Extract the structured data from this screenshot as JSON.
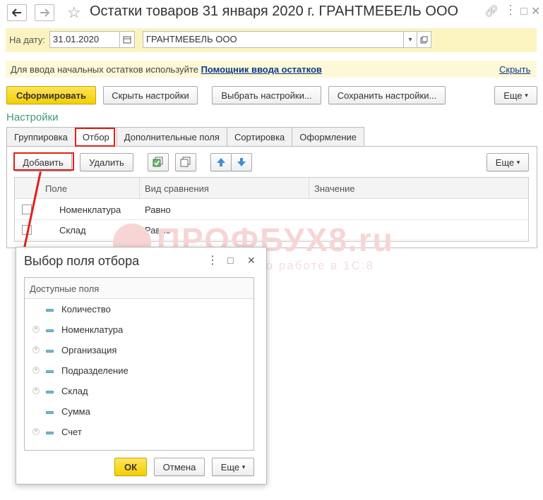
{
  "window": {
    "title": "Остатки товаров 31 января 2020 г. ГРАНТМЕБЕЛЬ ООО"
  },
  "filter": {
    "date_label": "На дату:",
    "date_value": "31.01.2020",
    "org_value": "ГРАНТМЕБЕЛЬ ООО"
  },
  "info": {
    "text": "Для ввода начальных остатков используйте",
    "link": "Помощник ввода остатков",
    "hide": "Скрыть"
  },
  "toolbar": {
    "generate": "Сформировать",
    "hide_settings": "Скрыть настройки",
    "choose_settings": "Выбрать настройки...",
    "save_settings": "Сохранить настройки...",
    "more": "Еще"
  },
  "settings": {
    "title": "Настройки",
    "tabs": [
      "Группировка",
      "Отбор",
      "Дополнительные поля",
      "Сортировка",
      "Оформление"
    ],
    "add": "Добавить",
    "delete": "Удалить",
    "more": "Еще",
    "columns": [
      "Поле",
      "Вид сравнения",
      "Значение"
    ],
    "rows": [
      {
        "field": "Номенклатура",
        "comparison": "Равно",
        "value": ""
      },
      {
        "field": "Склад",
        "comparison": "Равно",
        "value": ""
      }
    ]
  },
  "watermark": {
    "main": "ПРОФБУХ8.ru",
    "sub": "Онлайн-курсы по работе в 1С:8"
  },
  "dialog": {
    "title": "Выбор поля отбора",
    "header": "Доступные поля",
    "items": [
      {
        "label": "Количество",
        "expandable": false
      },
      {
        "label": "Номенклатура",
        "expandable": true
      },
      {
        "label": "Организация",
        "expandable": true
      },
      {
        "label": "Подразделение",
        "expandable": true
      },
      {
        "label": "Склад",
        "expandable": true
      },
      {
        "label": "Сумма",
        "expandable": false
      },
      {
        "label": "Счет",
        "expandable": true
      }
    ],
    "ok": "ОК",
    "cancel": "Отмена",
    "more": "Еще"
  }
}
